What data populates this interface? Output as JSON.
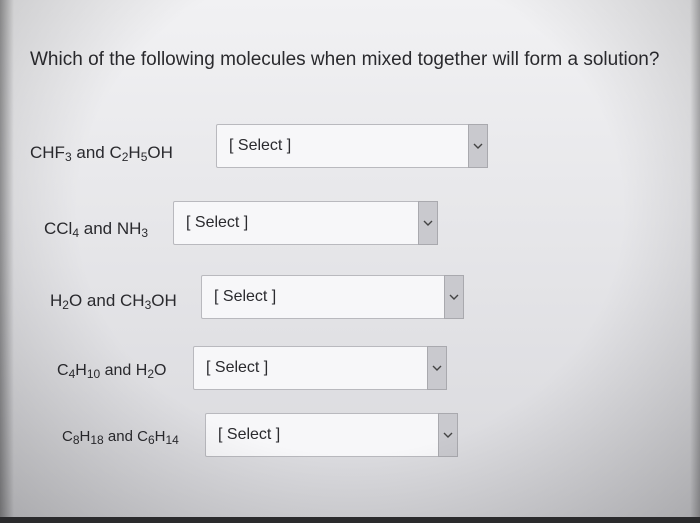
{
  "question": {
    "text": "Which of the following molecules when mixed together will form a solution?"
  },
  "rows": [
    {
      "label_parts": [
        "CHF",
        "3",
        " and C",
        "2",
        "H",
        "5",
        "OH"
      ],
      "select_value": "[ Select ]"
    },
    {
      "label_parts": [
        "CCl",
        "4",
        " and NH",
        "3"
      ],
      "select_value": "[ Select ]"
    },
    {
      "label_parts": [
        "H",
        "2",
        "O and CH",
        "3",
        "OH"
      ],
      "select_value": "[ Select ]"
    },
    {
      "label_parts": [
        "C",
        "4",
        "H",
        "10",
        " and H",
        "2",
        "O"
      ],
      "select_value": "[ Select ]"
    },
    {
      "label_parts": [
        "C",
        "8",
        "H",
        "18",
        " and C",
        "6",
        "H",
        "14"
      ],
      "select_value": "[ Select ]"
    }
  ],
  "icons": {
    "dropdown": "chevron-down-icon"
  }
}
